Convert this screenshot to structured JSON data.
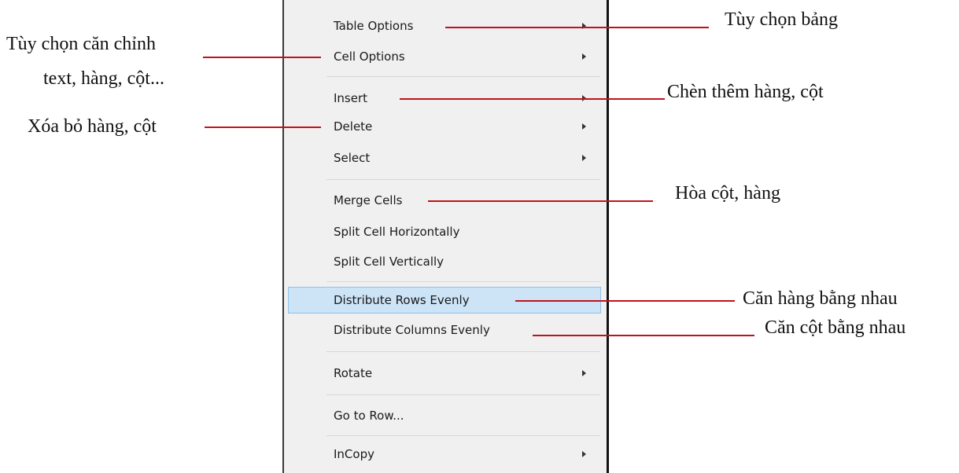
{
  "menu": {
    "items": [
      {
        "label": "Table Options",
        "has_submenu": true
      },
      {
        "label": "Cell Options",
        "has_submenu": true
      },
      {
        "label": "Insert",
        "has_submenu": true
      },
      {
        "label": "Delete",
        "has_submenu": true
      },
      {
        "label": "Select",
        "has_submenu": true
      },
      {
        "label": "Merge Cells",
        "has_submenu": false
      },
      {
        "label": "Split Cell Horizontally",
        "has_submenu": false
      },
      {
        "label": "Split Cell Vertically",
        "has_submenu": false
      },
      {
        "label": "Distribute Rows Evenly",
        "has_submenu": false,
        "highlighted": true
      },
      {
        "label": "Distribute Columns Evenly",
        "has_submenu": false
      },
      {
        "label": "Rotate",
        "has_submenu": true
      },
      {
        "label": "Go to Row...",
        "has_submenu": false
      },
      {
        "label": "InCopy",
        "has_submenu": true
      }
    ]
  },
  "annotations": {
    "table_options": "Tùy chọn bảng",
    "cell_options_line1": "Tùy chọn căn chỉnh",
    "cell_options_line2": "text, hàng, cột...",
    "insert": "Chèn thêm hàng, cột",
    "delete": "Xóa bỏ hàng, cột",
    "merge": "Hòa cột, hàng",
    "distribute_rows": "Căn hàng bằng nhau",
    "distribute_columns": "Căn cột bằng nhau"
  },
  "colors": {
    "callout_line": "#c0121d",
    "highlight_fill": "#cde4f7",
    "highlight_border": "#8ec0ea",
    "menu_background": "#f0f0f0"
  },
  "icons": {
    "submenu": "chevron-right-icon"
  }
}
